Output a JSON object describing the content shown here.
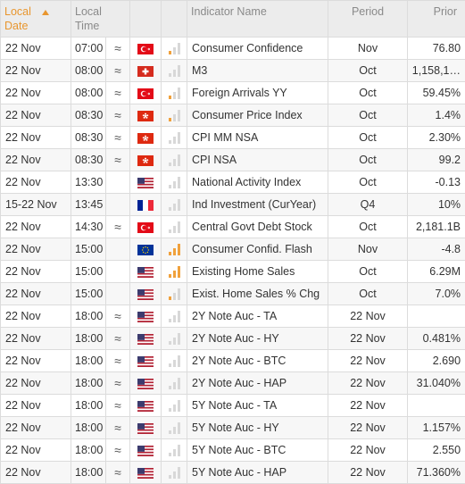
{
  "colors": {
    "header_bg": "#ececec",
    "header_text": "#8a8a8a",
    "sort_accent": "#e8962e",
    "impact_active": "#f0a13c",
    "impact_inactive": "#d8d8d8"
  },
  "header": {
    "local_date_line1": "Local",
    "local_date_line2": "Date",
    "local_time_line1": "Local",
    "local_time_line2": "Time",
    "indicator_name": "Indicator Name",
    "period": "Period",
    "prior": "Prior"
  },
  "rows": [
    {
      "date": "22 Nov",
      "time": "07:00",
      "similar": "≈",
      "flag": "TR",
      "impact": 1,
      "name": "Consumer Confidence",
      "period": "Nov",
      "prior": "76.80"
    },
    {
      "date": "22 Nov",
      "time": "08:00",
      "similar": "≈",
      "flag": "CH",
      "impact": 0,
      "name": "M3",
      "period": "Oct",
      "prior": "1,158,1…"
    },
    {
      "date": "22 Nov",
      "time": "08:00",
      "similar": "≈",
      "flag": "TR",
      "impact": 1,
      "name": "Foreign Arrivals YY",
      "period": "Oct",
      "prior": "59.45%"
    },
    {
      "date": "22 Nov",
      "time": "08:30",
      "similar": "≈",
      "flag": "HK",
      "impact": 1,
      "name": "Consumer Price Index",
      "period": "Oct",
      "prior": "1.4%"
    },
    {
      "date": "22 Nov",
      "time": "08:30",
      "similar": "≈",
      "flag": "HK",
      "impact": 0,
      "name": "CPI MM NSA",
      "period": "Oct",
      "prior": "2.30%"
    },
    {
      "date": "22 Nov",
      "time": "08:30",
      "similar": "≈",
      "flag": "HK",
      "impact": 0,
      "name": "CPI NSA",
      "period": "Oct",
      "prior": "99.2"
    },
    {
      "date": "22 Nov",
      "time": "13:30",
      "similar": "",
      "flag": "US",
      "impact": 0,
      "name": "National Activity Index",
      "period": "Oct",
      "prior": "-0.13"
    },
    {
      "date": "15-22 Nov",
      "time": "13:45",
      "similar": "",
      "flag": "FR",
      "impact": 0,
      "name": "Ind Investment (CurYear)",
      "period": "Q4",
      "prior": "10%"
    },
    {
      "date": "22 Nov",
      "time": "14:30",
      "similar": "≈",
      "flag": "TR",
      "impact": 0,
      "name": "Central Govt Debt Stock",
      "period": "Oct",
      "prior": "2,181.1B"
    },
    {
      "date": "22 Nov",
      "time": "15:00",
      "similar": "",
      "flag": "EU",
      "impact": 3,
      "name": "Consumer Confid. Flash",
      "period": "Nov",
      "prior": "-4.8"
    },
    {
      "date": "22 Nov",
      "time": "15:00",
      "similar": "",
      "flag": "US",
      "impact": 3,
      "name": "Existing Home Sales",
      "period": "Oct",
      "prior": "6.29M"
    },
    {
      "date": "22 Nov",
      "time": "15:00",
      "similar": "",
      "flag": "US",
      "impact": 1,
      "name": "Exist. Home Sales % Chg",
      "period": "Oct",
      "prior": "7.0%"
    },
    {
      "date": "22 Nov",
      "time": "18:00",
      "similar": "≈",
      "flag": "US",
      "impact": 0,
      "name": "2Y Note Auc - TA",
      "period": "22 Nov",
      "prior": ""
    },
    {
      "date": "22 Nov",
      "time": "18:00",
      "similar": "≈",
      "flag": "US",
      "impact": 0,
      "name": "2Y Note Auc - HY",
      "period": "22 Nov",
      "prior": "0.481%"
    },
    {
      "date": "22 Nov",
      "time": "18:00",
      "similar": "≈",
      "flag": "US",
      "impact": 0,
      "name": "2Y Note Auc - BTC",
      "period": "22 Nov",
      "prior": "2.690"
    },
    {
      "date": "22 Nov",
      "time": "18:00",
      "similar": "≈",
      "flag": "US",
      "impact": 0,
      "name": "2Y Note Auc - HAP",
      "period": "22 Nov",
      "prior": "31.040%"
    },
    {
      "date": "22 Nov",
      "time": "18:00",
      "similar": "≈",
      "flag": "US",
      "impact": 0,
      "name": "5Y Note Auc - TA",
      "period": "22 Nov",
      "prior": ""
    },
    {
      "date": "22 Nov",
      "time": "18:00",
      "similar": "≈",
      "flag": "US",
      "impact": 0,
      "name": "5Y Note Auc - HY",
      "period": "22 Nov",
      "prior": "1.157%"
    },
    {
      "date": "22 Nov",
      "time": "18:00",
      "similar": "≈",
      "flag": "US",
      "impact": 0,
      "name": "5Y Note Auc - BTC",
      "period": "22 Nov",
      "prior": "2.550"
    },
    {
      "date": "22 Nov",
      "time": "18:00",
      "similar": "≈",
      "flag": "US",
      "impact": 0,
      "name": "5Y Note Auc - HAP",
      "period": "22 Nov",
      "prior": "71.360%"
    }
  ]
}
